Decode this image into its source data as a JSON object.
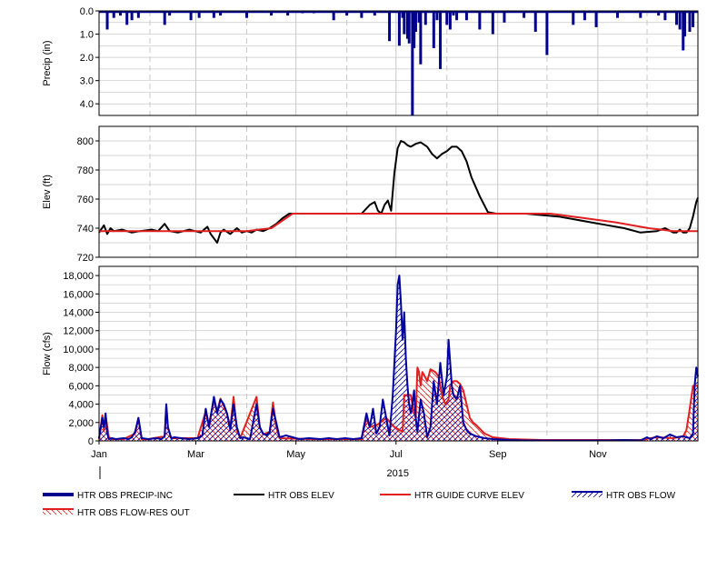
{
  "colors": {
    "precip": "#00008b",
    "elev": "#000000",
    "guide": "#e02020",
    "flow": "#0000a0",
    "resout": "#e02020",
    "grid": "#c8c8c8"
  },
  "chart_data": [
    {
      "type": "bar",
      "ylabel": "Precip (in)",
      "ylim": [
        4.5,
        0.0
      ],
      "yticks": [
        "0.0",
        "1.0",
        "2.0",
        "3.0",
        "4.0"
      ],
      "ytick_values": [
        0,
        1,
        2,
        3,
        4
      ],
      "grid": true,
      "series": [
        {
          "name": "HTR OBS PRECIP-INC",
          "x_day": [
            5,
            9,
            13,
            17,
            20,
            24,
            40,
            43,
            56,
            61,
            70,
            74,
            90,
            105,
            115,
            124,
            131,
            143,
            151,
            160,
            168,
            177,
            183,
            185,
            186,
            188,
            189,
            191,
            192,
            193,
            195,
            196,
            199,
            204,
            206,
            208,
            212,
            214,
            216,
            218,
            224,
            232,
            240,
            247,
            259,
            266,
            273,
            289,
            296,
            303,
            316,
            330,
            341,
            345,
            352,
            354,
            356,
            357,
            360,
            362
          ],
          "values": [
            0.8,
            0.3,
            0.2,
            0.6,
            0.4,
            0.3,
            0.6,
            0.2,
            0.4,
            0.3,
            0.3,
            0.2,
            0.3,
            0.2,
            0.2,
            0.1,
            0.1,
            0.4,
            0.2,
            0.3,
            0.2,
            1.3,
            1.5,
            0.3,
            1.0,
            1.2,
            1.4,
            4.5,
            1.6,
            0.9,
            0.5,
            2.3,
            0.6,
            1.6,
            0.4,
            2.5,
            0.6,
            0.8,
            0.2,
            0.4,
            0.4,
            0.8,
            1.0,
            0.5,
            0.3,
            0.9,
            1.9,
            0.6,
            0.4,
            0.7,
            0.3,
            0.3,
            0.2,
            0.4,
            0.6,
            0.8,
            1.7,
            1.1,
            0.9,
            0.7
          ]
        }
      ]
    },
    {
      "type": "line",
      "ylabel": "Elev (ft)",
      "ylim": [
        720,
        810
      ],
      "yticks": [
        "720",
        "740",
        "760",
        "780",
        "800"
      ],
      "ytick_values": [
        720,
        740,
        760,
        780,
        800
      ],
      "grid": true,
      "series": [
        {
          "name": "HTR OBS ELEV",
          "x_day": [
            0,
            3,
            5,
            7,
            9,
            14,
            20,
            25,
            32,
            36,
            40,
            43,
            48,
            55,
            62,
            66,
            68,
            70,
            72,
            74,
            76,
            80,
            84,
            87,
            90,
            93,
            96,
            100,
            104,
            108,
            112,
            116,
            120,
            125,
            130,
            135,
            140,
            150,
            160,
            165,
            168,
            170,
            172,
            174,
            176,
            178,
            180,
            182,
            184,
            186,
            188,
            190,
            193,
            196,
            200,
            203,
            206,
            209,
            212,
            215,
            218,
            221,
            224,
            227,
            232,
            237,
            242,
            245,
            248,
            250,
            260,
            280,
            290,
            300,
            310,
            320,
            330,
            340,
            345,
            350,
            352,
            354,
            356,
            358,
            360,
            362,
            364,
            365
          ],
          "values": [
            737,
            742,
            736,
            740,
            738,
            739,
            737,
            738,
            739,
            738,
            743,
            738,
            737,
            739,
            737,
            741,
            736,
            733,
            730,
            737,
            739,
            736,
            740,
            737,
            738,
            737,
            739,
            738,
            740,
            743,
            747,
            750,
            750,
            750,
            750,
            750,
            750,
            750,
            750,
            756,
            758,
            752,
            750,
            756,
            759,
            752,
            778,
            795,
            800,
            799,
            797,
            796,
            798,
            799,
            796,
            791,
            788,
            791,
            793,
            796,
            796,
            793,
            786,
            775,
            762,
            751,
            750,
            750,
            750,
            750,
            750,
            748,
            746,
            744,
            742,
            740,
            737,
            738,
            740,
            737,
            737,
            739,
            737,
            737,
            740,
            748,
            758,
            761
          ]
        },
        {
          "name": "HTR GUIDE CURVE ELEV",
          "x_day": [
            0,
            30,
            60,
            90,
            105,
            118,
            150,
            180,
            210,
            240,
            260,
            275,
            295,
            315,
            335,
            350,
            365
          ],
          "values": [
            738,
            738,
            738,
            738,
            740,
            750,
            750,
            750,
            750,
            750,
            750,
            750,
            747,
            744,
            740,
            738,
            738
          ]
        }
      ]
    },
    {
      "type": "area",
      "ylabel": "Flow (cfs)",
      "ylim": [
        0,
        19000
      ],
      "yticks": [
        "0",
        "2,000",
        "4,000",
        "6,000",
        "8,000",
        "10,000",
        "12,000",
        "14,000",
        "16,000",
        "18,000"
      ],
      "ytick_values": [
        0,
        2000,
        4000,
        6000,
        8000,
        10000,
        12000,
        14000,
        16000,
        18000
      ],
      "grid": true,
      "series": [
        {
          "name": "HTR OBS FLOW",
          "x_day": [
            0,
            2,
            3,
            4,
            5,
            6,
            8,
            10,
            15,
            18,
            20,
            22,
            24,
            26,
            30,
            35,
            38,
            40,
            41,
            42,
            44,
            46,
            50,
            55,
            60,
            63,
            65,
            67,
            70,
            72,
            74,
            76,
            78,
            80,
            82,
            84,
            86,
            88,
            90,
            92,
            96,
            98,
            100,
            102,
            104,
            106,
            108,
            110,
            114,
            118,
            122,
            128,
            135,
            140,
            145,
            150,
            155,
            160,
            163,
            165,
            167,
            169,
            171,
            173,
            175,
            177,
            179,
            181,
            182,
            183,
            184,
            185,
            186,
            187,
            188,
            189,
            190,
            191,
            192,
            193,
            194,
            196,
            198,
            200,
            202,
            204,
            206,
            208,
            210,
            212,
            213,
            214,
            215,
            216,
            218,
            220,
            222,
            224,
            226,
            230,
            235,
            240,
            250,
            260,
            270,
            280,
            290,
            300,
            310,
            320,
            330,
            334,
            336,
            340,
            344,
            348,
            352,
            356,
            360,
            362,
            363,
            364,
            365
          ],
          "values": [
            300,
            2500,
            1500,
            3000,
            800,
            200,
            300,
            200,
            300,
            200,
            400,
            1000,
            2500,
            300,
            200,
            300,
            200,
            500,
            4000,
            1500,
            300,
            400,
            300,
            200,
            300,
            600,
            3500,
            1500,
            4800,
            3000,
            4500,
            4000,
            3000,
            1200,
            4000,
            1500,
            300,
            400,
            300,
            200,
            4000,
            1500,
            800,
            600,
            1000,
            3500,
            2000,
            400,
            600,
            400,
            200,
            300,
            200,
            300,
            200,
            300,
            200,
            300,
            3000,
            1500,
            3500,
            800,
            1500,
            4500,
            2500,
            600,
            5000,
            12000,
            17000,
            18000,
            15000,
            11000,
            14000,
            9000,
            6000,
            4000,
            3000,
            4000,
            5500,
            2500,
            1000,
            4500,
            3000,
            400,
            1500,
            6500,
            4000,
            8500,
            5000,
            7000,
            11000,
            8500,
            6000,
            5000,
            4500,
            6000,
            2000,
            1200,
            800,
            500,
            300,
            200,
            100,
            50,
            50,
            50,
            50,
            50,
            50,
            100,
            50,
            400,
            200,
            500,
            300,
            700,
            400,
            500,
            300,
            800,
            6000,
            8000,
            7000
          ]
        },
        {
          "name": "HTR OBS FLOW-RES OUT",
          "x_day": [
            0,
            2,
            3,
            4,
            6,
            8,
            15,
            22,
            24,
            26,
            30,
            40,
            41,
            42,
            44,
            60,
            65,
            67,
            70,
            72,
            74,
            76,
            78,
            80,
            82,
            84,
            86,
            96,
            98,
            100,
            104,
            106,
            108,
            110,
            130,
            160,
            163,
            165,
            170,
            175,
            180,
            185,
            186,
            190,
            192,
            193,
            194,
            195,
            196,
            197,
            198,
            200,
            202,
            205,
            207,
            209,
            211,
            213,
            214,
            216,
            218,
            220,
            222,
            224,
            226,
            228,
            230,
            235,
            240,
            250,
            270,
            300,
            330,
            336,
            340,
            350,
            356,
            358,
            360,
            362,
            365
          ],
          "values": [
            200,
            2800,
            1200,
            2800,
            400,
            200,
            200,
            800,
            2500,
            200,
            200,
            500,
            3800,
            1400,
            300,
            300,
            3200,
            1800,
            4500,
            3200,
            4600,
            3800,
            3000,
            1500,
            4800,
            1200,
            300,
            4800,
            1500,
            700,
            1000,
            4200,
            1500,
            300,
            200,
            200,
            2500,
            1500,
            1800,
            2500,
            1500,
            1000,
            5000,
            5000,
            3000,
            2500,
            8000,
            7500,
            6000,
            7500,
            7200,
            6500,
            7800,
            7500,
            7000,
            5000,
            4000,
            4500,
            6000,
            6500,
            6500,
            6200,
            5500,
            4000,
            2500,
            2000,
            1700,
            800,
            400,
            200,
            100,
            100,
            100,
            300,
            400,
            300,
            500,
            1200,
            3500,
            6000,
            6000
          ]
        }
      ]
    }
  ],
  "x_axis": {
    "tick_labels": [
      "Jan",
      "Mar",
      "May",
      "Jul",
      "Sep",
      "Nov"
    ],
    "tick_days": [
      0,
      59,
      120,
      181,
      243,
      304
    ],
    "minor_days": [
      31,
      90,
      151,
      212,
      273,
      334
    ],
    "year_label": "2015",
    "xlim_days": [
      0,
      365
    ]
  },
  "legend": {
    "items": [
      {
        "label": "HTR OBS PRECIP-INC",
        "style": "thick",
        "color": "#00008b"
      },
      {
        "label": "HTR OBS ELEV",
        "style": "line",
        "color": "#000000"
      },
      {
        "label": "HTR GUIDE CURVE ELEV",
        "style": "line",
        "color": "#e02020"
      },
      {
        "label": "HTR OBS FLOW",
        "style": "hatch-blue",
        "color": "#0000a0"
      },
      {
        "label": "HTR OBS FLOW-RES OUT",
        "style": "hatch-red",
        "color": "#e02020"
      }
    ]
  }
}
